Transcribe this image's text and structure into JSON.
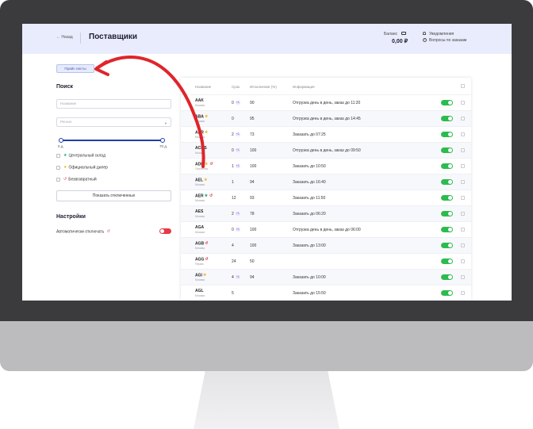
{
  "header": {
    "back_label": "← Назад",
    "title": "Поставщики",
    "balance_label": "Баланс",
    "balance_value": "0,00 ₽",
    "notifications_label": "Уведомления",
    "questions_label": "Вопросы по заказам"
  },
  "price_lists_button": "Прайс-листы",
  "search": {
    "title": "Поиск",
    "name_placeholder": "Название",
    "region_placeholder": "Регион",
    "range_min_label": "0 д.",
    "range_max_label": "70 д.",
    "filters": [
      {
        "label": "Центральный склад",
        "icon": "star-icon",
        "color": "#18a86b"
      },
      {
        "label": "Официальный дилер",
        "icon": "star-icon",
        "color": "#f0b323"
      },
      {
        "label": "Безвозвратный",
        "icon": "undo-icon",
        "color": "#e63946"
      }
    ],
    "show_disabled_button": "Показать отключенных"
  },
  "settings": {
    "title": "Настройки",
    "auto_disable_label": "Автоматически отключать"
  },
  "table": {
    "columns": [
      "Название",
      "Срок",
      "Исполнение (%)",
      "Информация"
    ],
    "rows": [
      {
        "code": "AAK",
        "city": "Москва",
        "term": "0",
        "pill": "+1",
        "exec": "90",
        "info": "Отгрузка день в день, заказ до 11:20"
      },
      {
        "code": "ABA",
        "city": "Москва",
        "term": "0",
        "pill": "",
        "exec": "95",
        "info": "Отгрузка день в день, заказ до 14:45"
      },
      {
        "code": "ABR",
        "city": "Москва",
        "term": "2",
        "pill": "+1",
        "exec": "73",
        "info": "Заказать до 07:25"
      },
      {
        "code": "ACMS",
        "city": "Москва",
        "term": "0",
        "pill": "+1",
        "exec": "100",
        "info": "Отгрузка день в день, заказ до 09:50"
      },
      {
        "code": "ADH",
        "city": "Смоленск",
        "term": "1",
        "pill": "+1",
        "exec": "100",
        "info": "Заказать до 10:50"
      },
      {
        "code": "AEL",
        "city": "Москва",
        "term": "1",
        "pill": "",
        "exec": "94",
        "info": "Заказать до 16:40"
      },
      {
        "code": "AER",
        "city": "Москва",
        "term": "12",
        "pill": "",
        "exec": "93",
        "info": "Заказать до 11:50"
      },
      {
        "code": "AES",
        "city": "Москва",
        "term": "2",
        "pill": "+1",
        "exec": "78",
        "info": "Заказать до 06:20"
      },
      {
        "code": "AGA",
        "city": "Москва",
        "term": "0",
        "pill": "+1",
        "exec": "100",
        "info": "Отгрузка день в день, заказ до 06:00"
      },
      {
        "code": "AGB",
        "city": "Москва",
        "term": "4",
        "pill": "",
        "exec": "100",
        "info": "Заказать до 13:00"
      },
      {
        "code": "AGG",
        "city": "Пермь",
        "term": "24",
        "pill": "",
        "exec": "50",
        "info": ""
      },
      {
        "code": "AGI",
        "city": "Москва",
        "term": "4",
        "pill": "+1",
        "exec": "94",
        "info": "Заказать до 10:00"
      },
      {
        "code": "AGL",
        "city": "Москва",
        "term": "5",
        "pill": "",
        "exec": "",
        "info": "Заказать до 15:50"
      }
    ]
  },
  "colors": {
    "accent": "#1f3ea8",
    "toggle_on": "#2dbb50",
    "toggle_off": "#e63946",
    "arrow": "#e0242b"
  }
}
